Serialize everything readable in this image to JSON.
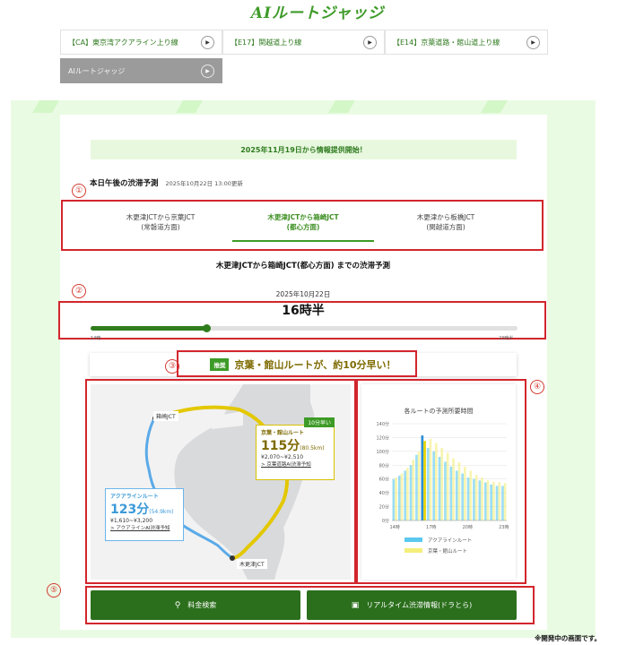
{
  "page_title": "AIルートジャッジ",
  "tabs": [
    {
      "label": "【CA】東京湾アクアライン上り線",
      "active": false
    },
    {
      "label": "【E17】関越道上り線",
      "active": false
    },
    {
      "label": "【E14】京葉道路・館山道上り線",
      "active": false
    },
    {
      "label": "AIルートジャッジ",
      "active": true
    }
  ],
  "notice": "2025年11月19日から情報提供開始！",
  "forecast": {
    "heading": "本日午後の渋滞予測",
    "updated": "2025年10月22日 13:00更新"
  },
  "directions": [
    {
      "line1": "木更津JCTから京葉JCT",
      "line2": "(常磐道方面)",
      "selected": false
    },
    {
      "line1": "木更津JCTから箱崎JCT",
      "line2": "(都心方面)",
      "selected": true
    },
    {
      "line1": "木更津から板橋JCT",
      "line2": "(関越道方面)",
      "selected": false
    }
  ],
  "route_caption": "木更津JCTから箱崎JCT(都心方面) までの渋滞予測",
  "date": "2025年10月22日",
  "time": "16時半",
  "slider": {
    "min_label": "14時",
    "max_label": "23時半",
    "value_fraction": 0.27
  },
  "recommendation": {
    "badge": "推奨",
    "text": "京葉・館山ルートが、約10分早い！"
  },
  "map": {
    "start_label": "木更津JCT",
    "end_label": "箱崎JCT",
    "keiyo": {
      "faster_tag": "10分早い",
      "name": "京葉・館山ルート",
      "time": "115分",
      "distance": "(80.5km)",
      "toll": "¥2,070~¥2,510",
      "link": "> 京葉道路AI渋滞予知"
    },
    "aqua": {
      "name": "アクアラインルート",
      "time": "123分",
      "distance": "(54.9km)",
      "toll": "¥1,610~¥3,200",
      "link": "> アクアラインAI渋滞予知"
    }
  },
  "chart_data": {
    "type": "bar",
    "title": "各ルートの予測所要時間",
    "xlabel": "",
    "ylabel": "",
    "y_ticks": [
      "0分",
      "20分",
      "40分",
      "60分",
      "80分",
      "100分",
      "120分",
      "140分"
    ],
    "ylim": [
      0,
      140
    ],
    "x_ticks": [
      "14時",
      "17時",
      "20時",
      "23時"
    ],
    "categories": [
      "14:00",
      "14:30",
      "15:00",
      "15:30",
      "16:00",
      "16:30",
      "17:00",
      "17:30",
      "18:00",
      "18:30",
      "19:00",
      "19:30",
      "20:00",
      "20:30",
      "21:00",
      "21:30",
      "22:00",
      "22:30",
      "23:00",
      "23:30"
    ],
    "series": [
      {
        "name": "アクアラインルート",
        "color": "#5bc8ef",
        "values": [
          60,
          65,
          72,
          80,
          95,
          123,
          105,
          100,
          92,
          85,
          78,
          72,
          68,
          62,
          60,
          58,
          55,
          52,
          50,
          50
        ]
      },
      {
        "name": "京葉・館山ルート",
        "color": "#f4ee7a",
        "values": [
          62,
          68,
          76,
          88,
          100,
          115,
          118,
          112,
          105,
          98,
          90,
          84,
          78,
          72,
          66,
          62,
          58,
          56,
          55,
          54
        ]
      }
    ],
    "highlight_index": 5,
    "grid": true,
    "legend_position": "bottom"
  },
  "buttons": {
    "fare": "料金検索",
    "realtime": "リアルタイム渋滞情報(ドラとら)"
  },
  "annotations": [
    "①",
    "②",
    "③",
    "④",
    "⑤"
  ],
  "footnote": "※開発中の画面です。"
}
